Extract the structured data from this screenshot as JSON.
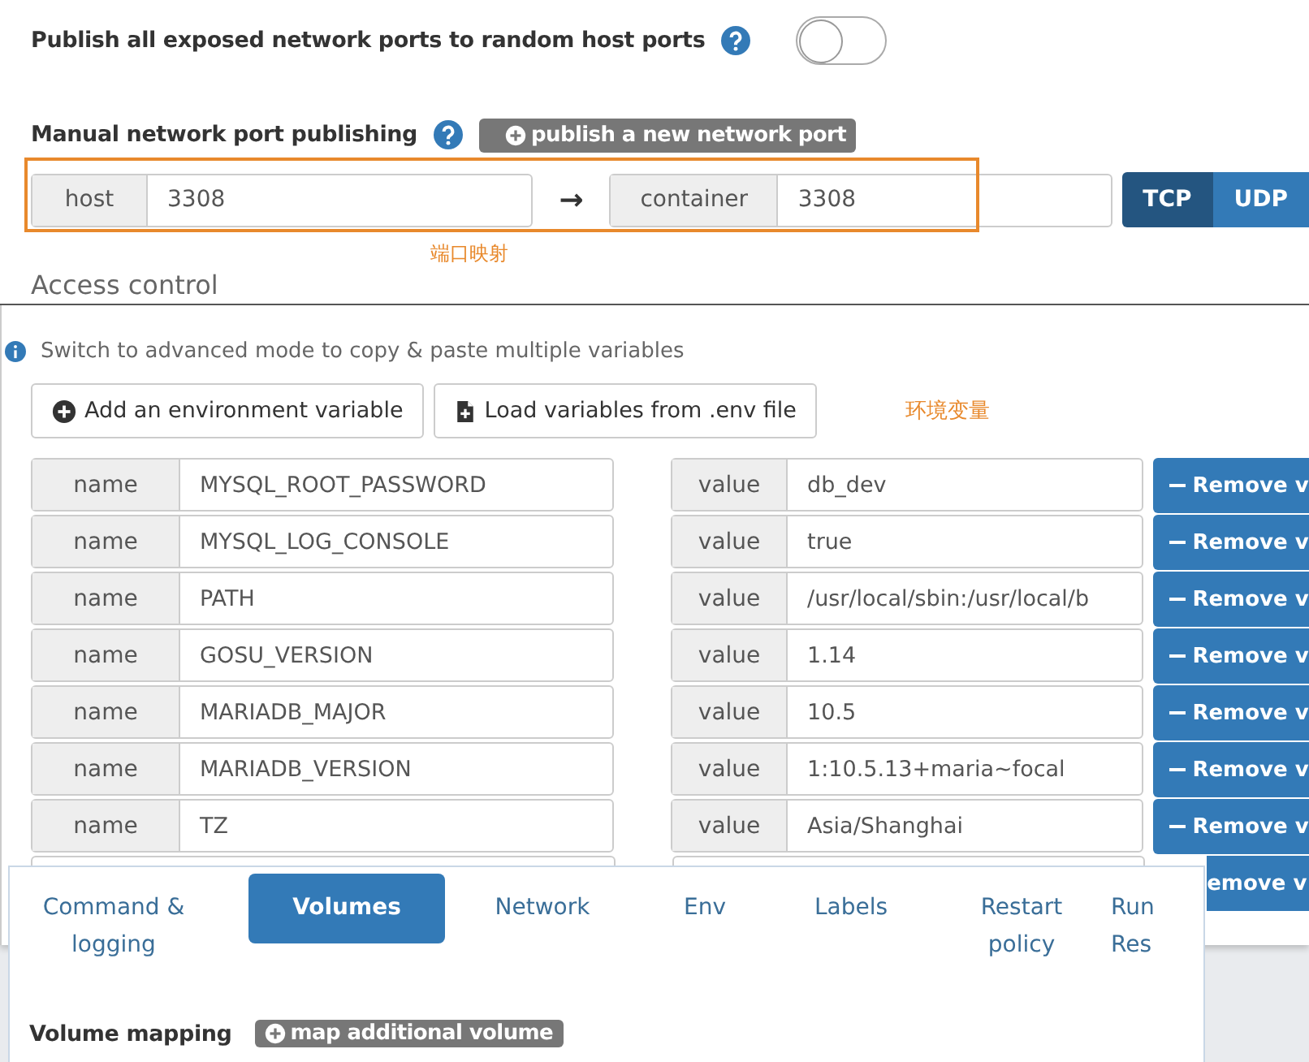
{
  "ports": {
    "publish_all": {
      "label": "Publish all exposed network ports to random host ports",
      "on": false
    },
    "manual": {
      "label": "Manual network port publishing",
      "button": "publish a new network port"
    },
    "mappings": [
      {
        "host_label": "host",
        "host": "3308",
        "arrow": "→",
        "container_label": "container",
        "container": "3308",
        "protocols": [
          {
            "label": "TCP",
            "selected": true
          },
          {
            "label": "UDP",
            "selected": false
          }
        ]
      }
    ],
    "annotation": "端口映射",
    "next_section": "Access control"
  },
  "env": {
    "hint": "Switch to advanced mode to copy & paste multiple variables",
    "buttons": [
      {
        "label": "Add an environment variable",
        "kind": "add"
      },
      {
        "label": "Load variables from .env file",
        "kind": "file"
      }
    ],
    "annotation": "环境变量",
    "variables": [
      {
        "name_label": "name",
        "name": "MYSQL_ROOT_PASSWORD",
        "value_label": "value",
        "value": "db_dev",
        "remove": "Remove v"
      },
      {
        "name_label": "name",
        "name": "MYSQL_LOG_CONSOLE",
        "value_label": "value",
        "value": "true",
        "remove": "Remove v"
      },
      {
        "name_label": "name",
        "name": "PATH",
        "value_label": "value",
        "value": "/usr/local/sbin:/usr/local/b",
        "remove": "Remove v"
      },
      {
        "name_label": "name",
        "name": "GOSU_VERSION",
        "value_label": "value",
        "value": "1.14",
        "remove": "Remove v"
      },
      {
        "name_label": "name",
        "name": "MARIADB_MAJOR",
        "value_label": "value",
        "value": "10.5",
        "remove": "Remove v"
      },
      {
        "name_label": "name",
        "name": "MARIADB_VERSION",
        "value_label": "value",
        "value": "1:10.5.13+maria~focal",
        "remove": "Remove v"
      },
      {
        "name_label": "name",
        "name": "TZ",
        "value_label": "value",
        "value": "Asia/Shanghai",
        "remove": "Remove v"
      },
      {
        "remove": "emove v"
      }
    ]
  },
  "settings": {
    "tabs": [
      {
        "label": "Command & logging",
        "selected": false
      },
      {
        "label": "Volumes",
        "selected": true
      },
      {
        "label": "Network",
        "selected": false
      },
      {
        "label": "Env",
        "selected": false
      },
      {
        "label": "Labels",
        "selected": false
      },
      {
        "label": "Restart policy",
        "selected": false
      },
      {
        "label": "Run Res",
        "selected": false
      }
    ],
    "volume_mapping": {
      "label": "Volume mapping",
      "button": "map additional volume"
    }
  }
}
